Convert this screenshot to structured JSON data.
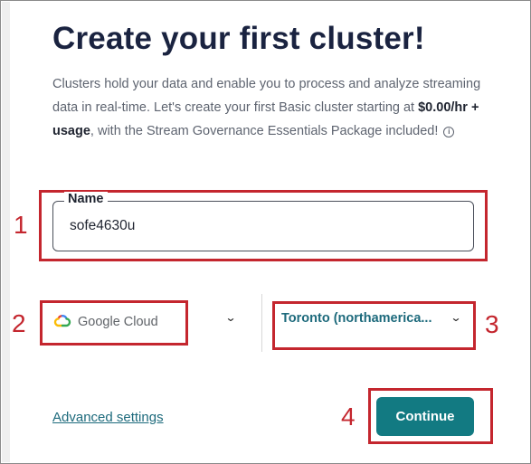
{
  "page": {
    "title": "Create your first cluster!",
    "description": {
      "part1": "Clusters hold your data and enable you to process and analyze streaming data in real-time. Let's create your first Basic cluster starting at ",
      "price": "$0.00/hr + usage",
      "part2": ", with the Stream Governance Essentials Package included!",
      "info_icon_glyph": "i"
    }
  },
  "form": {
    "name_label": "Name",
    "name_value": "sofe4630u",
    "provider": {
      "label": "Google Cloud",
      "icon": "google-cloud-logo"
    },
    "region": {
      "label": "Toronto (northamerica..."
    },
    "chevron_glyph": "⌄",
    "advanced_settings_label": "Advanced settings",
    "continue_label": "Continue"
  },
  "annotations": {
    "color": "#c4262e",
    "markers": [
      "1",
      "2",
      "3",
      "4"
    ]
  },
  "colors": {
    "title": "#1a2340",
    "accent": "#127a82",
    "link": "#1d6a7c"
  }
}
